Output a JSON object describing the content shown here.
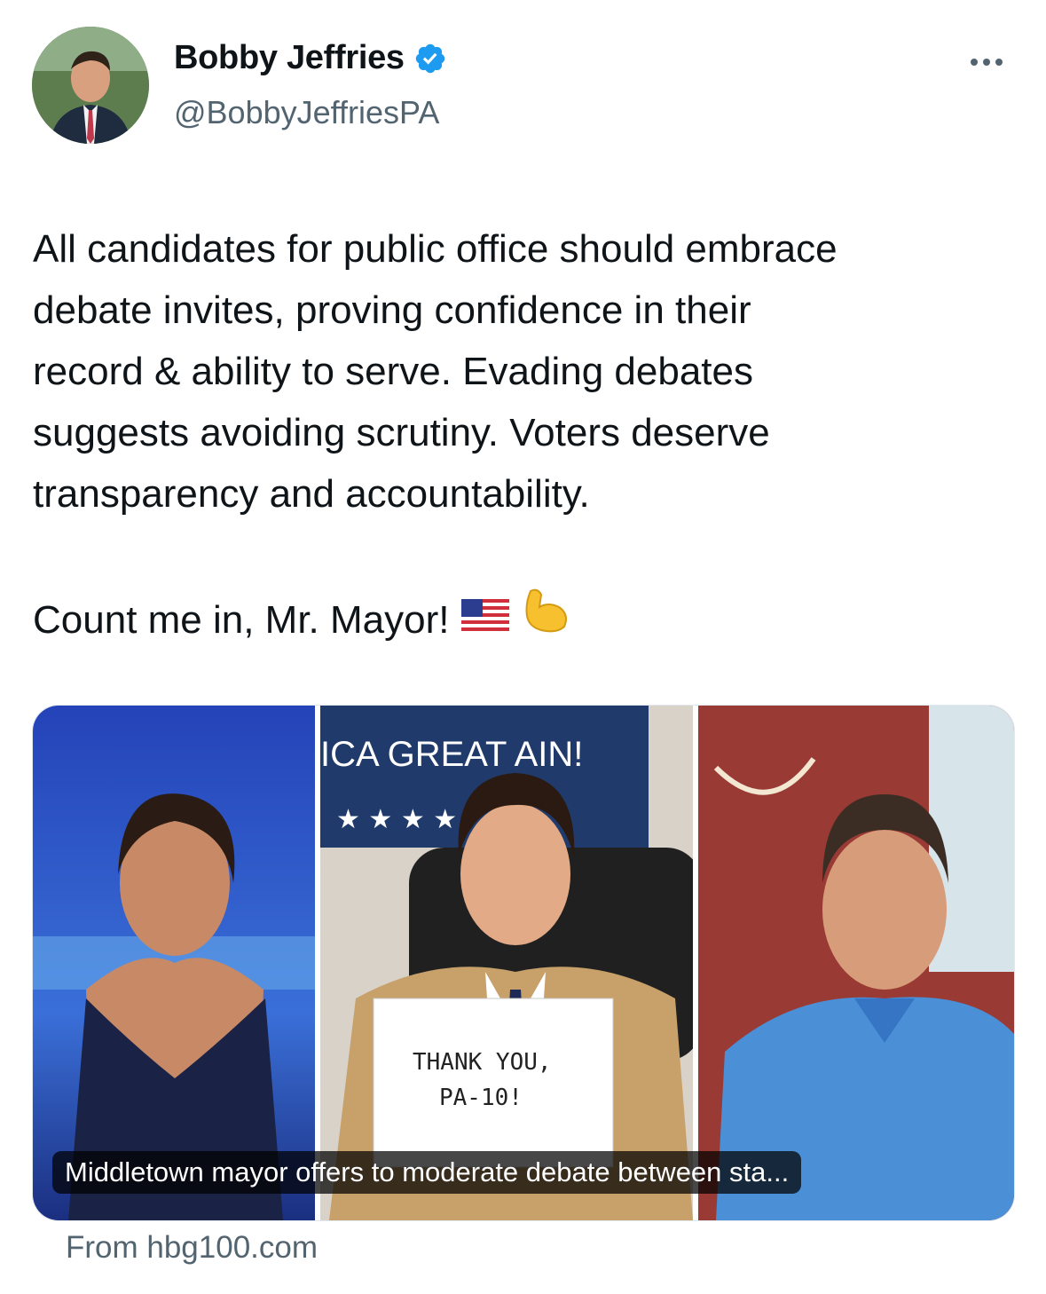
{
  "author": {
    "display_name": "Bobby Jeffries",
    "handle": "@BobbyJeffriesPA",
    "verified": true
  },
  "tweet": {
    "text": "All candidates for public office should embrace\ndebate invites, proving confidence in their\nrecord & ability to serve. Evading debates\nsuggests avoiding scrutiny. Voters deserve\ntransparency and accountability.",
    "second_line": "Count me in, Mr. Mayor!",
    "emojis": [
      "us-flag-emoji",
      "flexed-biceps-emoji"
    ]
  },
  "card": {
    "image_text": {
      "banner": "ICA GREAT AIN!",
      "sign_line1": "THANK YOU,",
      "sign_line2": "PA-10!"
    },
    "caption": "Middletown mayor offers to moderate debate between sta...",
    "source": "From hbg100.com"
  },
  "colors": {
    "accent": "#1d9bf0",
    "secondary_text": "#536471"
  }
}
